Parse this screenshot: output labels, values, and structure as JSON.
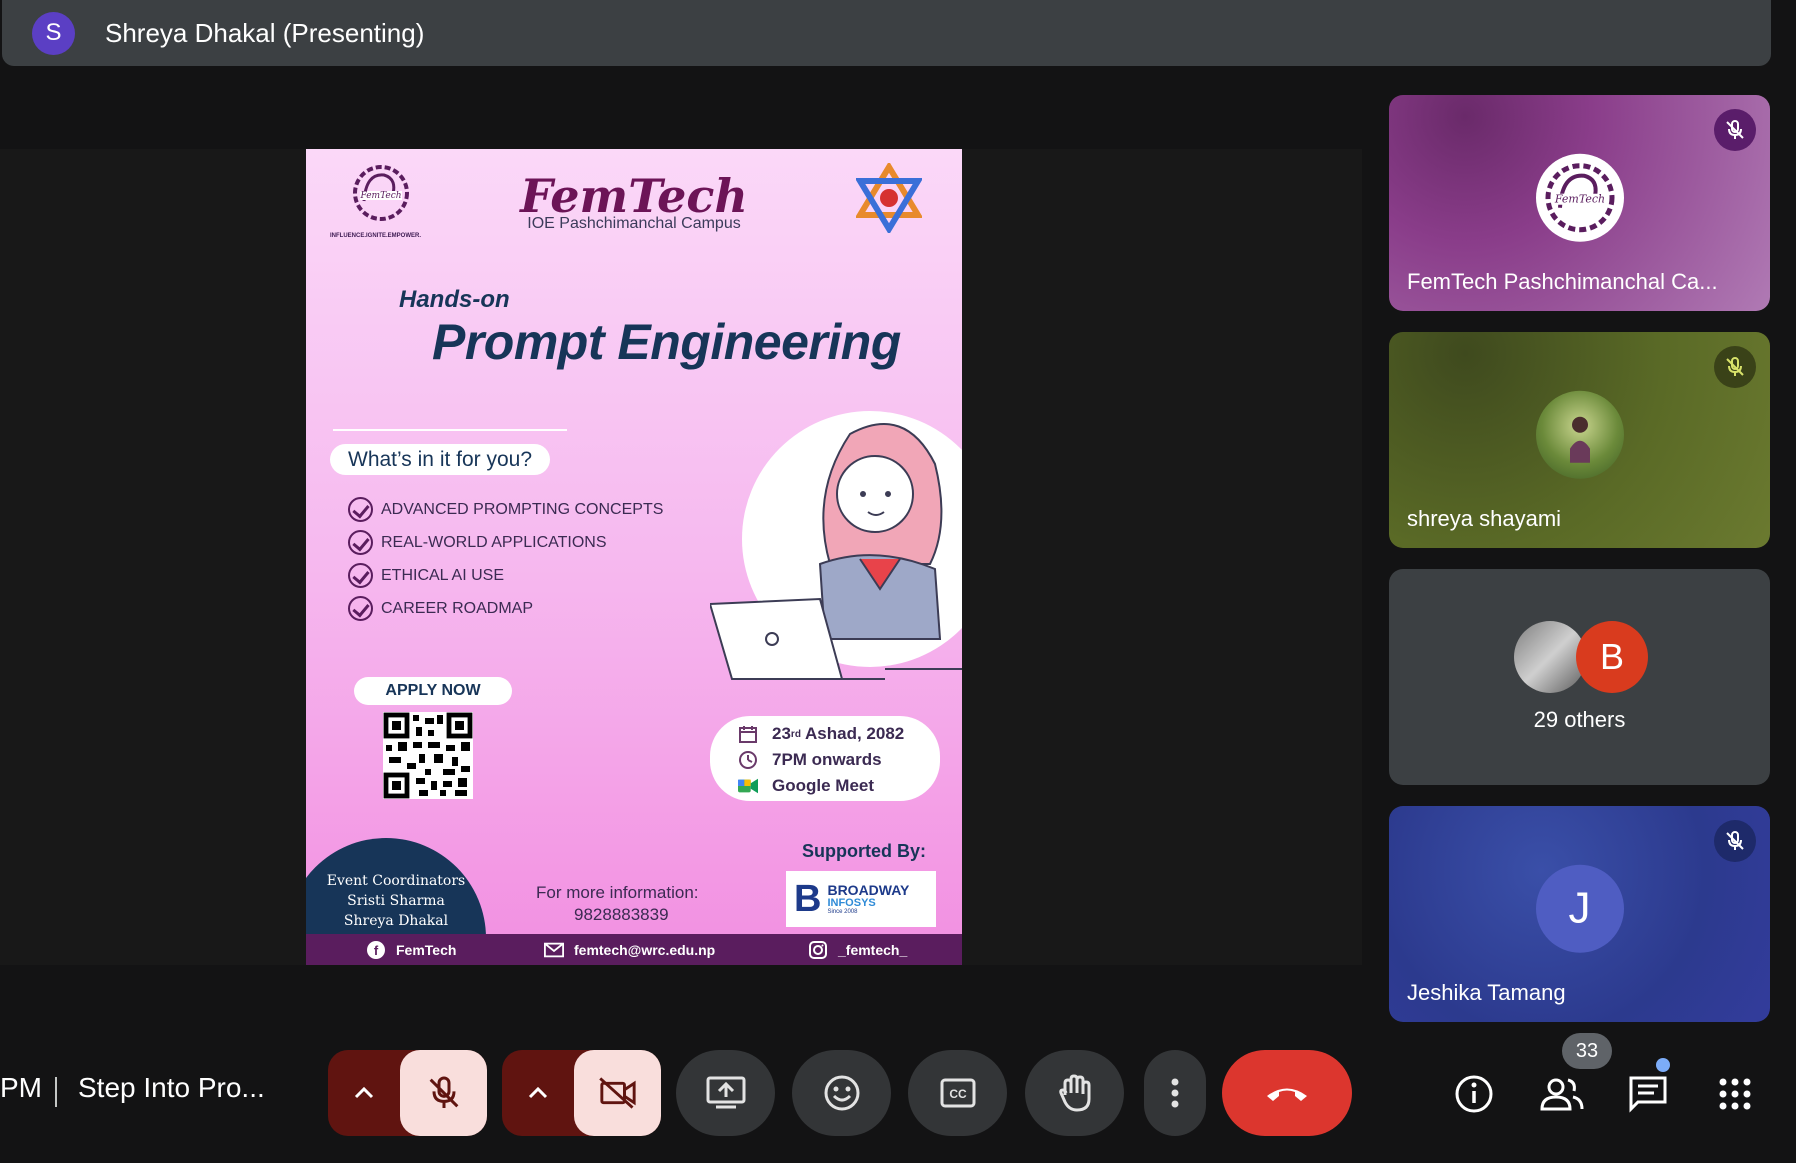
{
  "presenter": {
    "initial": "S",
    "label": "Shreya Dhakal (Presenting)"
  },
  "poster": {
    "logo_tagline": "INFLUENCE.IGNITE.EMPOWER.",
    "brand": "FemTech",
    "campus": "IOE Pashchimanchal Campus",
    "subtitle": "Hands-on",
    "title": "Prompt Engineering",
    "whats_in_it": "What’s in it for you?",
    "features": [
      "ADVANCED PROMPTING CONCEPTS",
      "REAL-WORLD APPLICATIONS",
      "ETHICAL AI USE",
      "CAREER ROADMAP"
    ],
    "apply_label": "APPLY NOW",
    "event": {
      "date_day": "23",
      "date_suffix": "rd",
      "date_rest": " Ashad, 2082",
      "time": "7PM onwards",
      "platform": "Google Meet"
    },
    "coordinators": {
      "heading": "Event Coordinators",
      "names": [
        "Sristi Sharma",
        "Shreya Dhakal"
      ]
    },
    "info_label": "For more information:",
    "info_phone": "9828883839",
    "supported_by": "Supported By:",
    "sponsor": {
      "letter": "B",
      "name": "BROADWAY",
      "sub": "INFOSYS",
      "since": "Since 2008"
    },
    "footer": {
      "facebook": "FemTech",
      "email": "femtech@wrc.edu.np",
      "instagram": "_femtech_"
    }
  },
  "participants": [
    {
      "name": "FemTech Pashchimanchal Ca...",
      "muted": true
    },
    {
      "name": "shreya shayami",
      "muted": true
    },
    {
      "others_label": "29 others",
      "others_initial": "B"
    },
    {
      "name": "Jeshika Tamang",
      "initial": "J",
      "muted": true
    }
  ],
  "controls": {
    "time_fragment": "PM",
    "meeting_title": "Step Into Pro...",
    "people_count": "33"
  },
  "colors": {
    "end_call": "#dc362e",
    "mic_off_bg": "#f9dedc",
    "mic_off_chevron_bg": "#601410",
    "control_bg": "#333537"
  }
}
